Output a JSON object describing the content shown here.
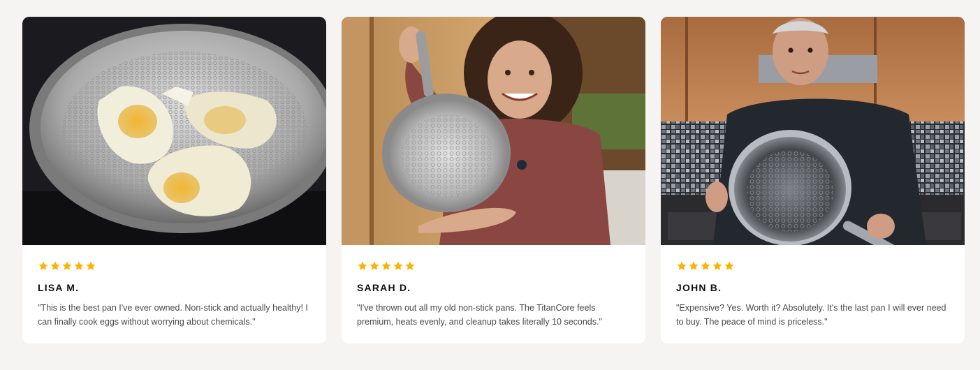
{
  "colors": {
    "page_background": "#f5f4f2",
    "card_background": "#ffffff",
    "star": "#f9b400",
    "name": "#111111",
    "quote": "#4a4a4a"
  },
  "reviews": [
    {
      "rating": 5,
      "name": "LISA M.",
      "quote": "\"This is the best pan I've ever owned. Non-stick and actually healthy! I can finally cook eggs without worrying about chemicals.\"",
      "photo_icon": "fried-eggs-in-pan-photo"
    },
    {
      "rating": 5,
      "name": "SARAH D.",
      "quote": "\"I've thrown out all my old non-stick pans. The TitanCore feels premium, heats evenly, and cleanup takes literally 10 seconds.\"",
      "photo_icon": "woman-holding-pan-photo"
    },
    {
      "rating": 5,
      "name": "JOHN B.",
      "quote": "\"Expensive? Yes. Worth it? Absolutely. It's the last pan I will ever need to buy. The peace of mind is priceless.\"",
      "photo_icon": "man-holding-pan-photo"
    }
  ]
}
